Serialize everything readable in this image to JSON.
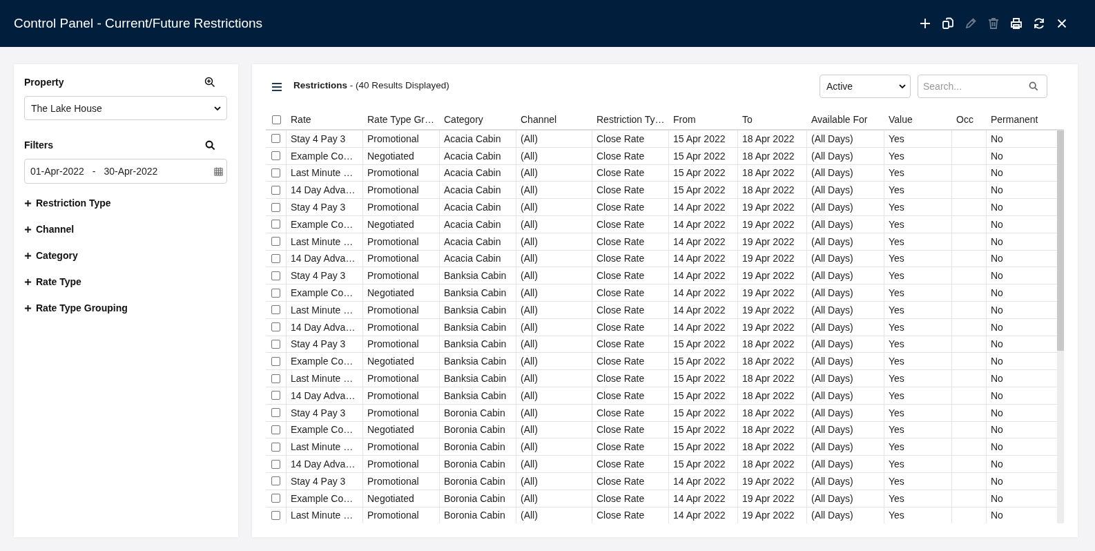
{
  "window": {
    "title": "Control Panel - Current/Future Restrictions"
  },
  "toolbar": [
    {
      "kind": "add",
      "disabled": false
    },
    {
      "kind": "copy",
      "disabled": false
    },
    {
      "kind": "edit",
      "disabled": true
    },
    {
      "kind": "delete",
      "disabled": true
    },
    {
      "kind": "print",
      "disabled": false
    },
    {
      "kind": "refresh",
      "disabled": false
    },
    {
      "kind": "close",
      "disabled": false
    }
  ],
  "sidebar": {
    "property_label": "Property",
    "property_value": "The Lake House",
    "filters_label": "Filters",
    "date_from": "01-Apr-2022",
    "date_separator": "-",
    "date_to": "30-Apr-2022",
    "filter_groups": [
      {
        "label": "Restriction Type",
        "expanded": false
      },
      {
        "label": "Channel",
        "expanded": false
      },
      {
        "label": "Category",
        "expanded": false
      },
      {
        "label": "Rate Type",
        "expanded": false
      },
      {
        "label": "Rate Type Grouping",
        "expanded": false
      }
    ]
  },
  "panel": {
    "title": "Restrictions",
    "subtitle": "- (40 Results Displayed)",
    "status_filter": "Active",
    "search": {
      "placeholder": "Search..."
    }
  },
  "table": {
    "all_checked": false,
    "columns": [
      "Rate",
      "Rate Type Gr…",
      "Category",
      "Channel",
      "Restriction Ty…",
      "From",
      "To",
      "Available For",
      "Value",
      "Occ",
      "Permanent"
    ],
    "rows": [
      {
        "checked": false,
        "cells": [
          "Stay 4 Pay 3",
          "Promotional",
          "Acacia Cabin",
          "(All)",
          "Close Rate",
          "15 Apr 2022",
          "18 Apr 2022",
          "(All Days)",
          "Yes",
          "",
          "No"
        ]
      },
      {
        "checked": false,
        "cells": [
          "Example Co…",
          "Negotiated",
          "Acacia Cabin",
          "(All)",
          "Close Rate",
          "15 Apr 2022",
          "18 Apr 2022",
          "(All Days)",
          "Yes",
          "",
          "No"
        ]
      },
      {
        "checked": false,
        "cells": [
          "Last Minute …",
          "Promotional",
          "Acacia Cabin",
          "(All)",
          "Close Rate",
          "15 Apr 2022",
          "18 Apr 2022",
          "(All Days)",
          "Yes",
          "",
          "No"
        ]
      },
      {
        "checked": false,
        "cells": [
          "14 Day Adva…",
          "Promotional",
          "Acacia Cabin",
          "(All)",
          "Close Rate",
          "15 Apr 2022",
          "18 Apr 2022",
          "(All Days)",
          "Yes",
          "",
          "No"
        ]
      },
      {
        "checked": false,
        "cells": [
          "Stay 4 Pay 3",
          "Promotional",
          "Acacia Cabin",
          "(All)",
          "Close Rate",
          "14 Apr 2022",
          "19 Apr 2022",
          "(All Days)",
          "Yes",
          "",
          "No"
        ]
      },
      {
        "checked": false,
        "cells": [
          "Example Co…",
          "Negotiated",
          "Acacia Cabin",
          "(All)",
          "Close Rate",
          "14 Apr 2022",
          "19 Apr 2022",
          "(All Days)",
          "Yes",
          "",
          "No"
        ]
      },
      {
        "checked": false,
        "cells": [
          "Last Minute …",
          "Promotional",
          "Acacia Cabin",
          "(All)",
          "Close Rate",
          "14 Apr 2022",
          "19 Apr 2022",
          "(All Days)",
          "Yes",
          "",
          "No"
        ]
      },
      {
        "checked": false,
        "cells": [
          "14 Day Adva…",
          "Promotional",
          "Acacia Cabin",
          "(All)",
          "Close Rate",
          "14 Apr 2022",
          "19 Apr 2022",
          "(All Days)",
          "Yes",
          "",
          "No"
        ]
      },
      {
        "checked": false,
        "cells": [
          "Stay 4 Pay 3",
          "Promotional",
          "Banksia Cabin",
          "(All)",
          "Close Rate",
          "14 Apr 2022",
          "19 Apr 2022",
          "(All Days)",
          "Yes",
          "",
          "No"
        ]
      },
      {
        "checked": false,
        "cells": [
          "Example Co…",
          "Negotiated",
          "Banksia Cabin",
          "(All)",
          "Close Rate",
          "14 Apr 2022",
          "19 Apr 2022",
          "(All Days)",
          "Yes",
          "",
          "No"
        ]
      },
      {
        "checked": false,
        "cells": [
          "Last Minute …",
          "Promotional",
          "Banksia Cabin",
          "(All)",
          "Close Rate",
          "14 Apr 2022",
          "19 Apr 2022",
          "(All Days)",
          "Yes",
          "",
          "No"
        ]
      },
      {
        "checked": false,
        "cells": [
          "14 Day Adva…",
          "Promotional",
          "Banksia Cabin",
          "(All)",
          "Close Rate",
          "14 Apr 2022",
          "19 Apr 2022",
          "(All Days)",
          "Yes",
          "",
          "No"
        ]
      },
      {
        "checked": false,
        "cells": [
          "Stay 4 Pay 3",
          "Promotional",
          "Banksia Cabin",
          "(All)",
          "Close Rate",
          "15 Apr 2022",
          "18 Apr 2022",
          "(All Days)",
          "Yes",
          "",
          "No"
        ]
      },
      {
        "checked": false,
        "cells": [
          "Example Co…",
          "Negotiated",
          "Banksia Cabin",
          "(All)",
          "Close Rate",
          "15 Apr 2022",
          "18 Apr 2022",
          "(All Days)",
          "Yes",
          "",
          "No"
        ]
      },
      {
        "checked": false,
        "cells": [
          "Last Minute …",
          "Promotional",
          "Banksia Cabin",
          "(All)",
          "Close Rate",
          "15 Apr 2022",
          "18 Apr 2022",
          "(All Days)",
          "Yes",
          "",
          "No"
        ]
      },
      {
        "checked": false,
        "cells": [
          "14 Day Adva…",
          "Promotional",
          "Banksia Cabin",
          "(All)",
          "Close Rate",
          "15 Apr 2022",
          "18 Apr 2022",
          "(All Days)",
          "Yes",
          "",
          "No"
        ]
      },
      {
        "checked": false,
        "cells": [
          "Stay 4 Pay 3",
          "Promotional",
          "Boronia Cabin",
          "(All)",
          "Close Rate",
          "15 Apr 2022",
          "18 Apr 2022",
          "(All Days)",
          "Yes",
          "",
          "No"
        ]
      },
      {
        "checked": false,
        "cells": [
          "Example Co…",
          "Negotiated",
          "Boronia Cabin",
          "(All)",
          "Close Rate",
          "15 Apr 2022",
          "18 Apr 2022",
          "(All Days)",
          "Yes",
          "",
          "No"
        ]
      },
      {
        "checked": false,
        "cells": [
          "Last Minute …",
          "Promotional",
          "Boronia Cabin",
          "(All)",
          "Close Rate",
          "15 Apr 2022",
          "18 Apr 2022",
          "(All Days)",
          "Yes",
          "",
          "No"
        ]
      },
      {
        "checked": false,
        "cells": [
          "14 Day Adva…",
          "Promotional",
          "Boronia Cabin",
          "(All)",
          "Close Rate",
          "15 Apr 2022",
          "18 Apr 2022",
          "(All Days)",
          "Yes",
          "",
          "No"
        ]
      },
      {
        "checked": false,
        "cells": [
          "Stay 4 Pay 3",
          "Promotional",
          "Boronia Cabin",
          "(All)",
          "Close Rate",
          "14 Apr 2022",
          "19 Apr 2022",
          "(All Days)",
          "Yes",
          "",
          "No"
        ]
      },
      {
        "checked": false,
        "cells": [
          "Example Co…",
          "Negotiated",
          "Boronia Cabin",
          "(All)",
          "Close Rate",
          "14 Apr 2022",
          "19 Apr 2022",
          "(All Days)",
          "Yes",
          "",
          "No"
        ]
      },
      {
        "checked": false,
        "cells": [
          "Last Minute …",
          "Promotional",
          "Boronia Cabin",
          "(All)",
          "Close Rate",
          "14 Apr 2022",
          "19 Apr 2022",
          "(All Days)",
          "Yes",
          "",
          "No"
        ]
      }
    ]
  }
}
